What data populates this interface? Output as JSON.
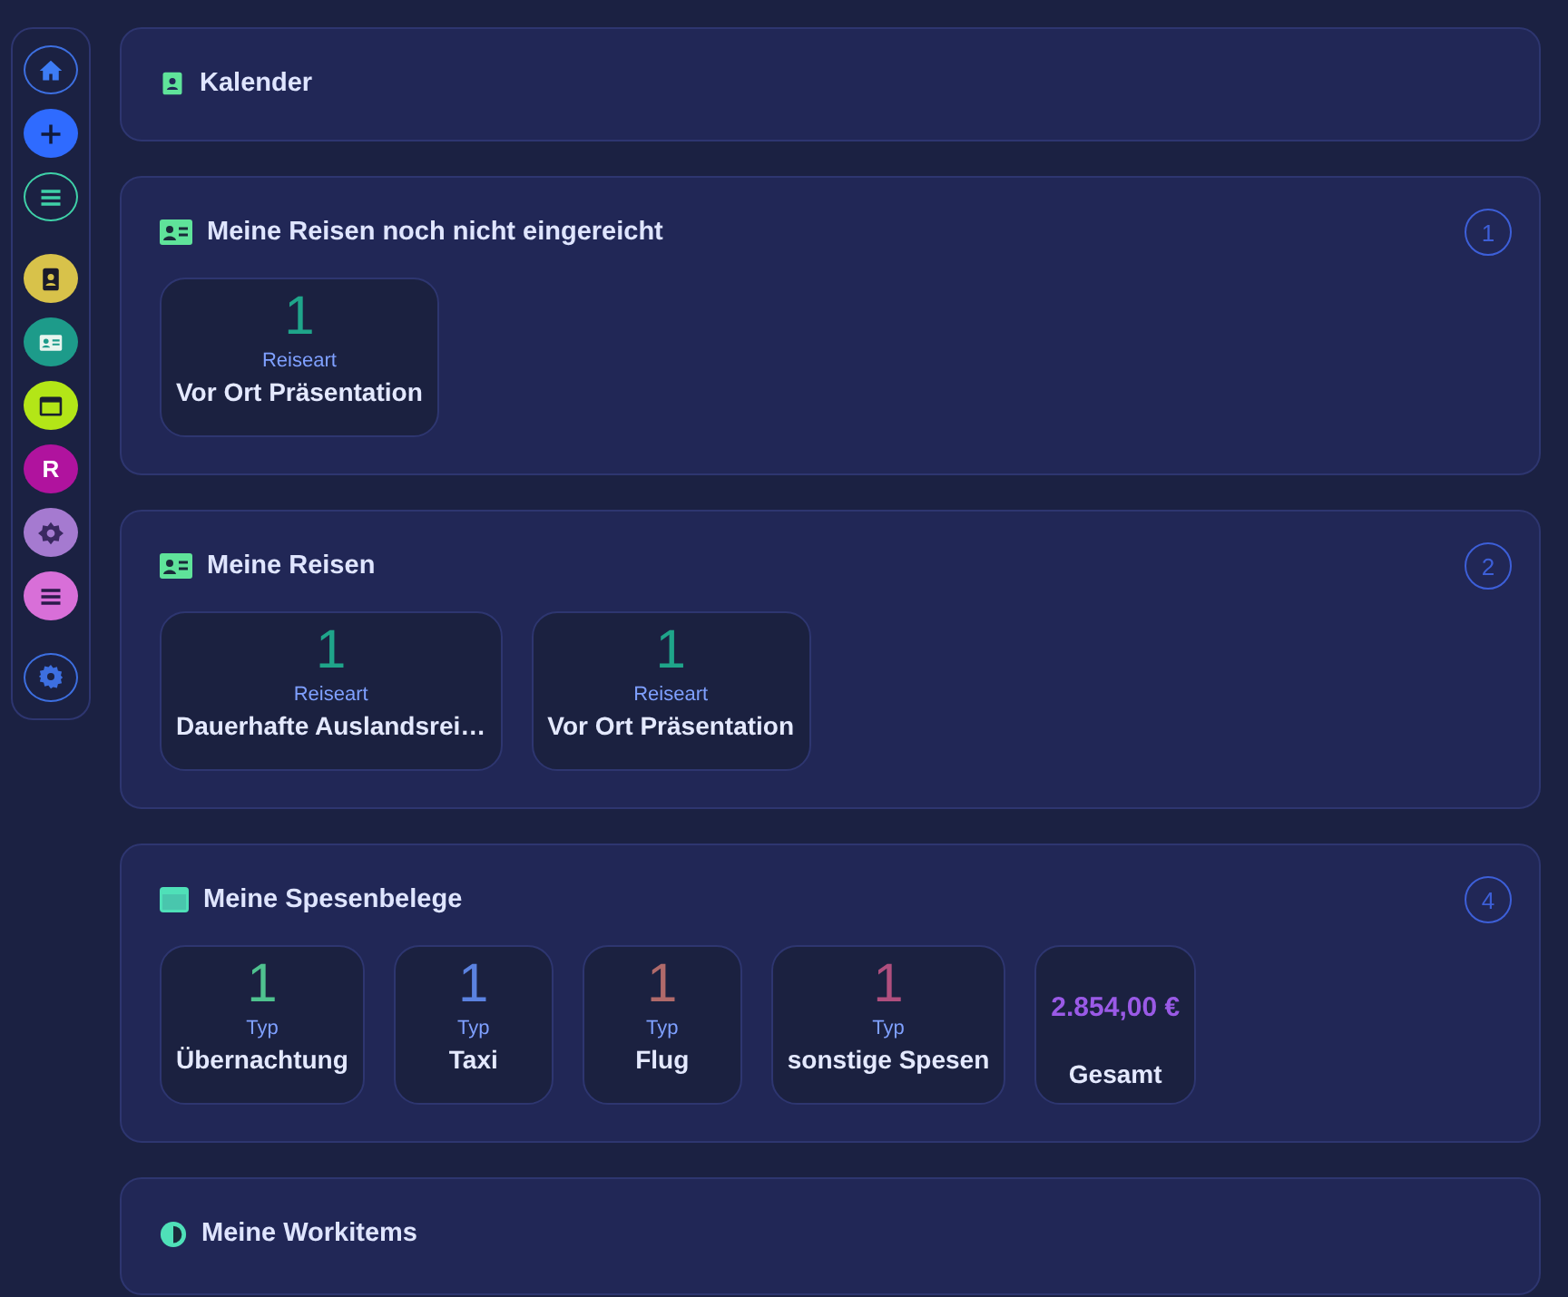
{
  "sidebar": {
    "items": [
      {
        "kind": "outline",
        "color": "#3d6fe0"
      },
      {
        "kind": "filled",
        "color": "#2f6bff"
      },
      {
        "kind": "outline",
        "color": "#3fd1a8"
      },
      {
        "kind": "filled",
        "color": "#d8c24a"
      },
      {
        "kind": "filled",
        "color": "#1d9b8a"
      },
      {
        "kind": "filled",
        "color": "#b3e617"
      },
      {
        "kind": "letter",
        "color": "#b0139e",
        "label": "R"
      },
      {
        "kind": "filled",
        "color": "#a57ad0"
      },
      {
        "kind": "filled",
        "color": "#d86fd8"
      },
      {
        "kind": "outline",
        "color": "#3d6fe0"
      }
    ]
  },
  "sections": [
    {
      "title": "Kalender"
    },
    {
      "title": "Meine Reisen noch nicht eingereicht",
      "count": "1",
      "tiles": [
        {
          "kind": "count",
          "value": "1",
          "caption": "Reiseart",
          "label": "Vor Ort Präsentation",
          "color": "#1fa58a"
        }
      ]
    },
    {
      "title": "Meine Reisen",
      "count": "2",
      "tiles": [
        {
          "kind": "count",
          "value": "1",
          "caption": "Reiseart",
          "label": "Dauerhafte Auslandsrei…",
          "color": "#1fa58a"
        },
        {
          "kind": "count",
          "value": "1",
          "caption": "Reiseart",
          "label": "Vor Ort Präsentation",
          "color": "#1fa58a"
        }
      ]
    },
    {
      "title": "Meine Spesenbelege",
      "count": "4",
      "tiles": [
        {
          "kind": "count",
          "value": "1",
          "caption": "Typ",
          "label": "Übernachtung",
          "color": "#4fc28f"
        },
        {
          "kind": "count",
          "value": "1",
          "caption": "Typ",
          "label": "Taxi",
          "color": "#5b82e0"
        },
        {
          "kind": "count",
          "value": "1",
          "caption": "Typ",
          "label": "Flug",
          "color": "#b06a6a"
        },
        {
          "kind": "count",
          "value": "1",
          "caption": "Typ",
          "label": "sonstige Spesen",
          "color": "#b04f7e"
        },
        {
          "kind": "total",
          "value": "2.854,00 €",
          "label": "Gesamt",
          "color": "#9a5ae6"
        }
      ]
    },
    {
      "title": "Meine Workitems"
    }
  ]
}
